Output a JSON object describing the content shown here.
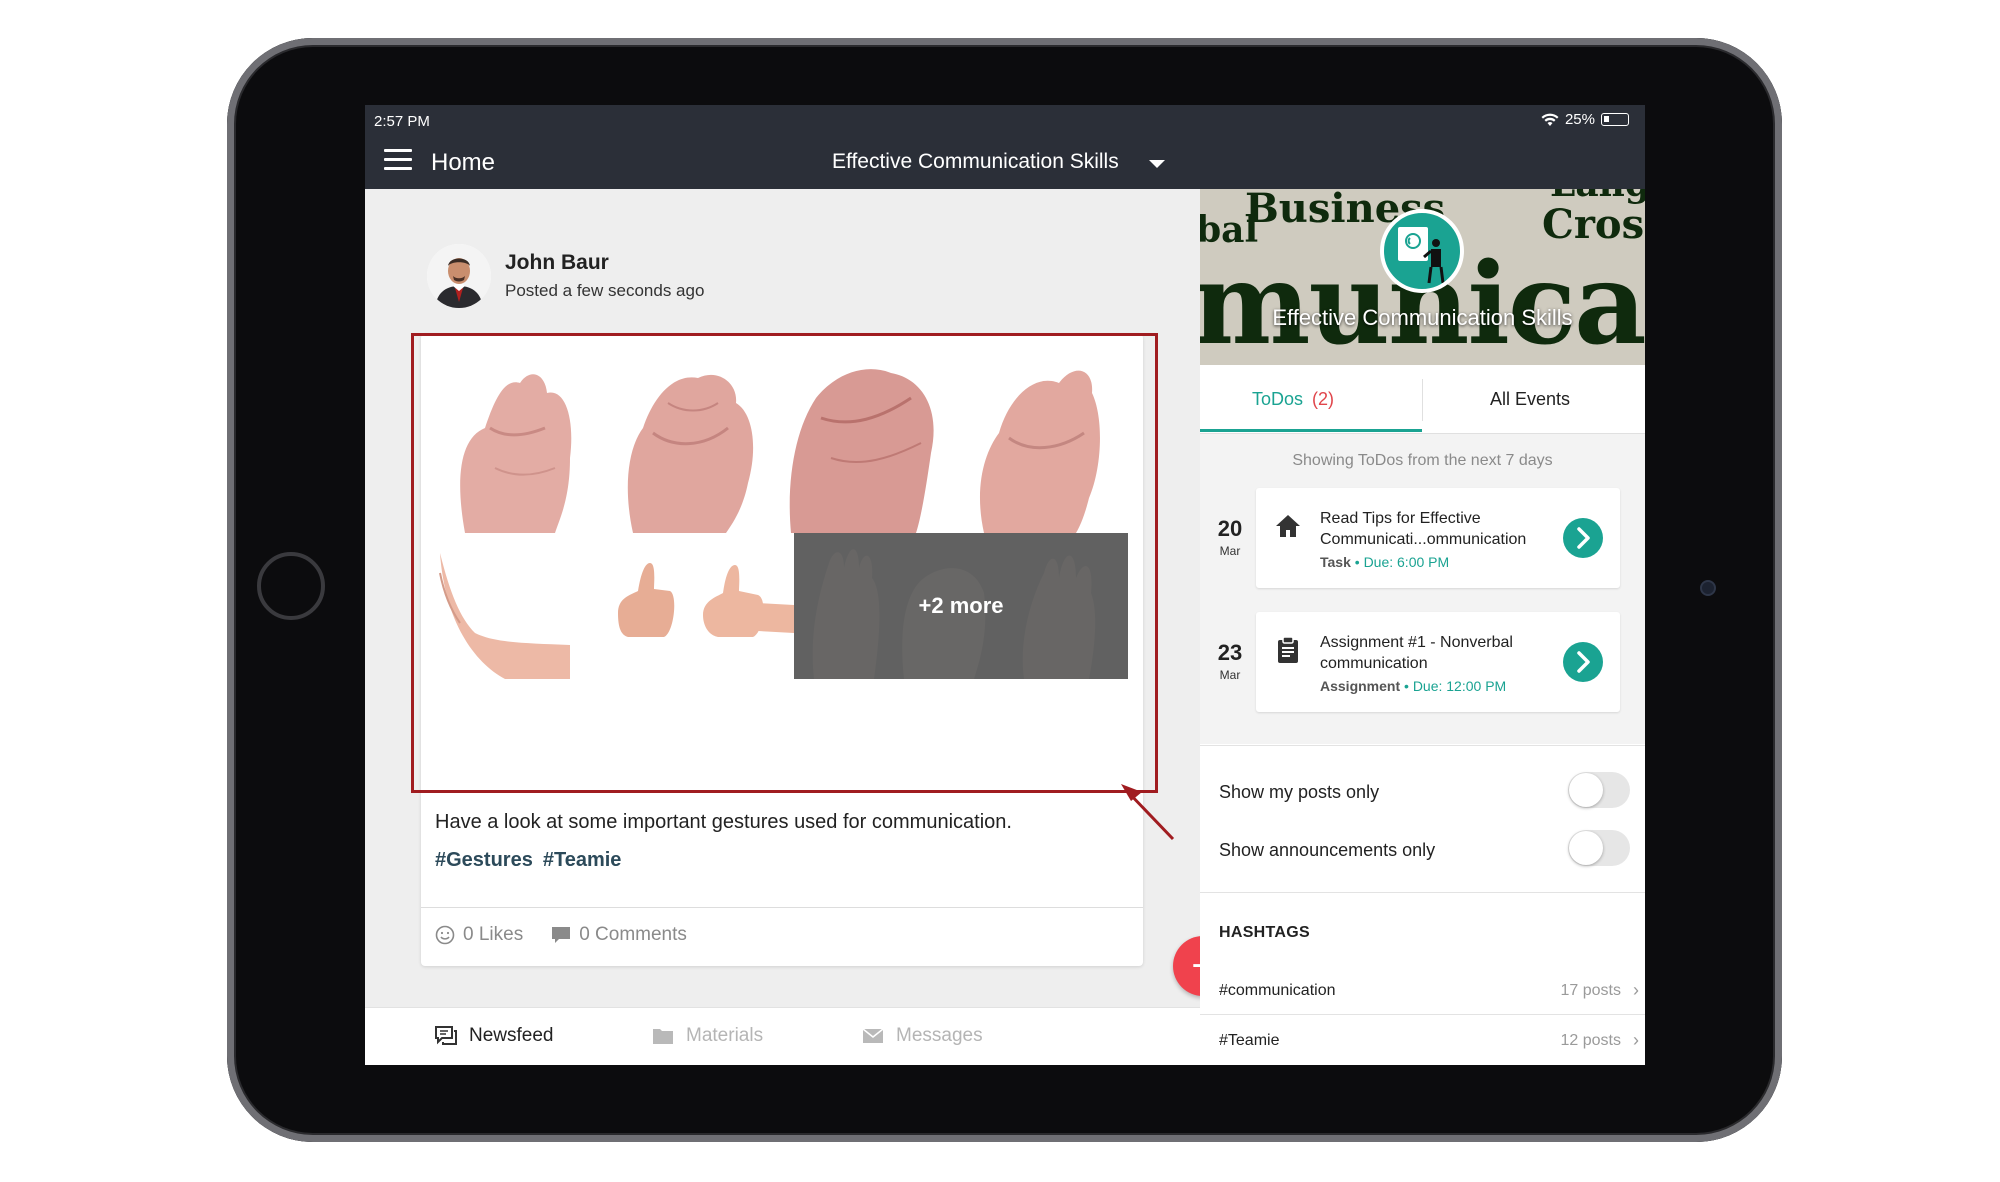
{
  "status_bar": {
    "time": "2:57 PM",
    "battery": "25%"
  },
  "app_bar": {
    "title": "Home",
    "course": "Effective Communication Skills"
  },
  "post": {
    "author": "John Baur",
    "posted": "Posted a few seconds ago",
    "more_images": "+2 more",
    "text": "Have a look at some important gestures used for communication.",
    "hashtags": [
      "#Gestures",
      "#Teamie"
    ],
    "likes": "0 Likes",
    "comments": "0 Comments"
  },
  "bottom_tabs": [
    {
      "label": "Newsfeed",
      "active": true,
      "icon": "newsfeed-icon"
    },
    {
      "label": "Materials",
      "active": false,
      "icon": "folder-icon"
    },
    {
      "label": "Messages",
      "active": false,
      "icon": "mail-icon"
    }
  ],
  "side_panel": {
    "banner_title": "Effective Communication Skills",
    "banner_words": [
      "Business",
      "Cross",
      "bal",
      "municat",
      "Langu"
    ],
    "tabs": {
      "todos_label": "ToDos",
      "todos_count": "(2)",
      "events_label": "All Events"
    },
    "todo_note": "Showing ToDos from the next 7 days",
    "todos": [
      {
        "day": "20",
        "month": "Mar",
        "title": "Read Tips for Effective Communicati...ommunication",
        "kind": "Task",
        "due": "Due: 6:00 PM",
        "icon": "home-icon"
      },
      {
        "day": "23",
        "month": "Mar",
        "title": "Assignment #1 - Nonverbal communication",
        "kind": "Assignment",
        "due": "Due: 12:00 PM",
        "icon": "clipboard-icon"
      }
    ],
    "toggles": [
      {
        "label": "Show my posts only",
        "on": false
      },
      {
        "label": "Show announcements only",
        "on": false
      }
    ],
    "hashtags_heading": "HASHTAGS",
    "hashtags": [
      {
        "name": "#communication",
        "count": "17 posts"
      },
      {
        "name": "#Teamie",
        "count": "12 posts"
      }
    ]
  },
  "colors": {
    "accent": "#1aa392",
    "fab": "#f0424d",
    "appbar": "#2b2f38",
    "highlight": "#a01c20",
    "count": "#e0454b"
  }
}
